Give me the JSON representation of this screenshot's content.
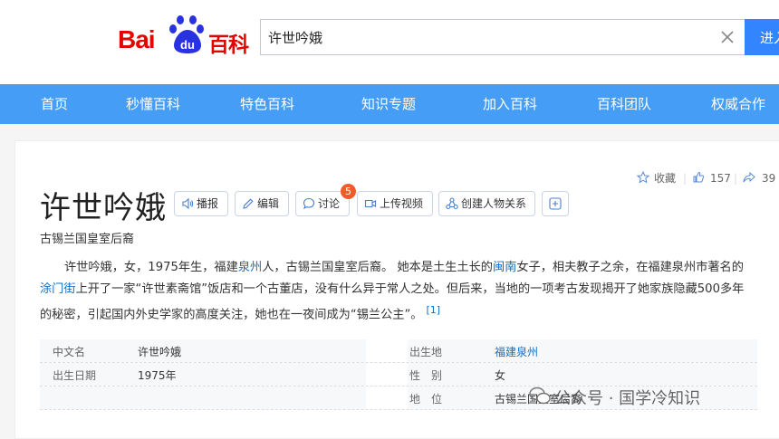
{
  "header": {
    "logo_text_left": "Bai",
    "logo_paw_text": "du",
    "logo_text_right": "百科",
    "search_value": "许世吟娥",
    "search_button": "进入"
  },
  "nav": [
    "首页",
    "秒懂百科",
    "特色百科",
    "知识专题",
    "加入百科",
    "百科团队",
    "权威合作"
  ],
  "side_actions": {
    "collect": "收藏",
    "likes": "157",
    "shares": "39"
  },
  "entry": {
    "title": "许世吟娥",
    "subtitle": "古锡兰国皇室后裔",
    "tools": {
      "broadcast": "播报",
      "edit": "编辑",
      "discuss": "讨论",
      "discuss_badge": "5",
      "upload_video": "上传视频",
      "relation": "创建人物关系"
    },
    "summary": {
      "p1": "许世吟娥，女，1975年生，福建",
      "link1": "泉州",
      "p2": "人，古锡兰国皇室后裔。 她本是土生土长的",
      "link2": "闽南",
      "p3": "女子，相夫教子之余，在福建泉州市著名的",
      "link3": "涂门街",
      "p4": "上开了一家“许世素斋馆”饭店和一个古董店，没有什么异于常人之处。但后来，当地的一项考古发现揭开了她家族隐藏500多年的秘密，引起国内外史学家的高度关注，她也在一夜间成为“锡兰公主”。",
      "ref": "[1]"
    },
    "info": [
      {
        "k1": "中文名",
        "v1": "许世吟娥",
        "k2": "出生地",
        "v2": "福建泉州"
      },
      {
        "k1": "出生日期",
        "v1": "1975年",
        "k2": "性　别",
        "v2": "女"
      },
      {
        "k1": "",
        "v1": "",
        "k2": "地　位",
        "v2": "古锡兰国皇室后裔"
      }
    ]
  },
  "watermark": "公众号 · 国学冷知识",
  "colors": {
    "nav": "#459df5",
    "brand_red": "#e10602",
    "brand_blue": "#2932e1",
    "link": "#136ec2",
    "button": "#3385ff"
  }
}
